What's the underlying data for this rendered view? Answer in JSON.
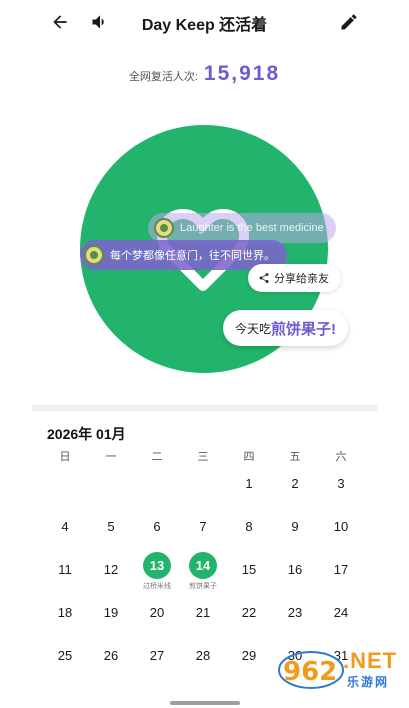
{
  "header": {
    "title": "Day Keep 还活着",
    "back_icon": "arrow-left-icon",
    "sound_icon": "speaker-icon",
    "edit_icon": "pencil-icon"
  },
  "counter": {
    "label": "全网复活人次:",
    "value": "15,918"
  },
  "hero": {
    "danmu_1": "Laughter is the best medicine",
    "danmu_2": "每个梦都像任意门，往不同世界。",
    "share_label": "分享给亲友",
    "today_prefix": "今天吃",
    "today_food": "煎饼果子!"
  },
  "calendar": {
    "month_label": "2026年 01月",
    "weekdays": [
      "日",
      "一",
      "二",
      "三",
      "四",
      "五",
      "六"
    ],
    "days": [
      "",
      "",
      "",
      "",
      "1",
      "2",
      "3",
      "4",
      "5",
      "6",
      "7",
      "8",
      "9",
      "10",
      "11",
      "12",
      "13",
      "14",
      "15",
      "16",
      "17",
      "18",
      "19",
      "20",
      "21",
      "22",
      "23",
      "24",
      "25",
      "26",
      "27",
      "28",
      "29",
      "30",
      "31"
    ],
    "notes": {
      "13": "过桥米线",
      "14": "煎饼果子"
    }
  },
  "watermark": {
    "number": "962",
    "suffix": ".NET",
    "sub": "乐游网"
  },
  "colors": {
    "green": "#22b46c",
    "purple": "#6f5bd3",
    "watermark_orange": "#f29a1c",
    "watermark_blue": "#2e7ad1"
  }
}
